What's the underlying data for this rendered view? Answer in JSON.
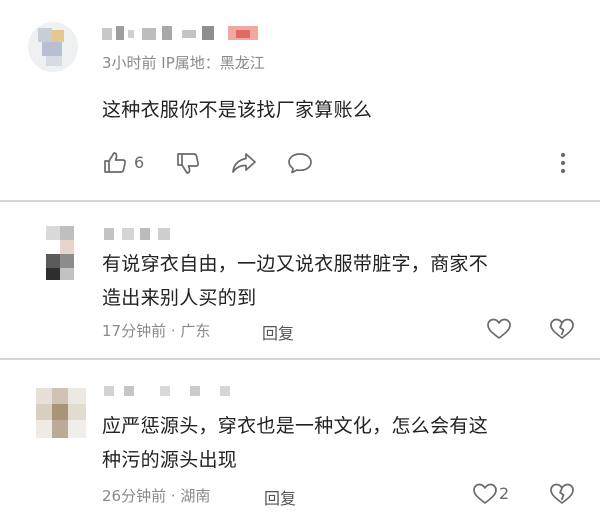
{
  "comments": [
    {
      "meta": "3小时前 IP属地：黑龙江",
      "text": "这种衣服你不是该找厂家算账么",
      "like_count": "6",
      "icons": [
        "like-icon",
        "dislike-icon",
        "share-icon",
        "comment-icon",
        "more-icon"
      ]
    },
    {
      "text_line1": "有说穿衣自由，一边又说衣服带脏字，商家不",
      "text_line2": "造出来别人买的到",
      "meta": "17分钟前 · 广东",
      "reply_label": "回复",
      "like_count": "",
      "icons": [
        "heart-icon",
        "broken-heart-icon"
      ]
    },
    {
      "text_line1": "应严惩源头，穿衣也是一种文化，怎么会有这",
      "text_line2": "种污的源头出现",
      "meta": "26分钟前 · 湖南",
      "reply_label": "回复",
      "like_count": "2",
      "icons": [
        "heart-icon",
        "broken-heart-icon"
      ]
    }
  ],
  "colors": {
    "text": "#222222",
    "meta": "#8a8a8a",
    "icon": "#6a6a6a",
    "divider": "#d6d6d6"
  }
}
